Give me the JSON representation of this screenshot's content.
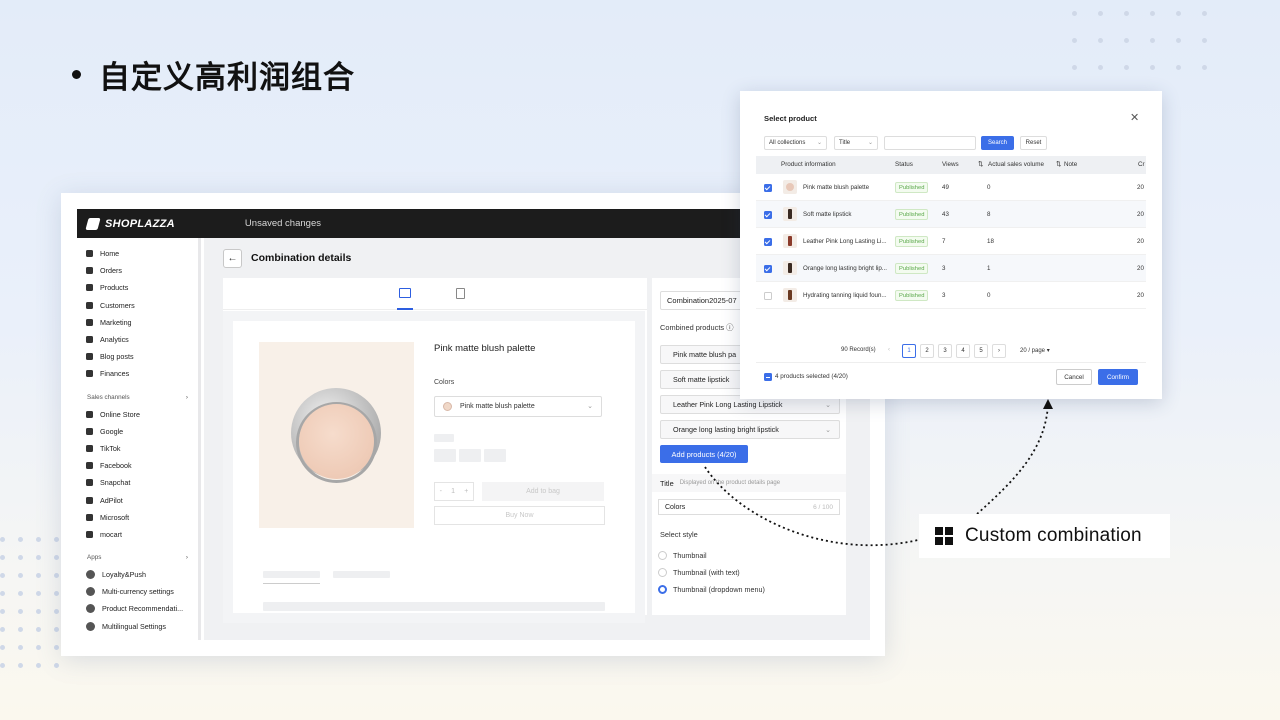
{
  "slide": {
    "title": "自定义高利润组合"
  },
  "topbar": {
    "logo": "SHOPLAZZA",
    "status": "Unsaved changes"
  },
  "sidebar": {
    "items": [
      {
        "label": "Home",
        "icon": "home-icon"
      },
      {
        "label": "Orders",
        "icon": "orders-icon"
      },
      {
        "label": "Products",
        "icon": "tag-icon"
      },
      {
        "label": "Customers",
        "icon": "user-icon"
      },
      {
        "label": "Marketing",
        "icon": "megaphone-icon"
      },
      {
        "label": "Analytics",
        "icon": "chart-icon"
      },
      {
        "label": "Blog posts",
        "icon": "blog-icon"
      },
      {
        "label": "Finances",
        "icon": "wallet-icon"
      }
    ],
    "sales_channels_label": "Sales channels",
    "channels": [
      {
        "label": "Online Store"
      },
      {
        "label": "Google"
      },
      {
        "label": "TikTok"
      },
      {
        "label": "Facebook"
      },
      {
        "label": "Snapchat"
      },
      {
        "label": "AdPilot"
      },
      {
        "label": "Microsoft"
      },
      {
        "label": "mocart"
      }
    ],
    "apps_label": "Apps",
    "apps": [
      {
        "label": "Loyalty&Push"
      },
      {
        "label": "Multi-currency settings"
      },
      {
        "label": "Product Recommendati..."
      },
      {
        "label": "Multilingual Settings"
      }
    ]
  },
  "main": {
    "page_title": "Combination details",
    "preview": {
      "product_name": "Pink matte blush palette",
      "colors_label": "Colors",
      "color_selected": "Pink matte blush palette",
      "qty_minus": "-",
      "qty_value": "1",
      "qty_plus": "+",
      "add_to_bag": "Add to bag",
      "buy_now": "Buy Now"
    },
    "settings": {
      "name_value": "Combination2025-07",
      "combined_products_label": "Combined products",
      "products": [
        "Pink matte blush pa",
        "Soft matte lipstick",
        "Leather Pink Long Lasting Lipstick",
        "Orange long lasting bright lipstick"
      ],
      "add_button": "Add products (4/20)",
      "title_label": "Title",
      "title_hint": "Displayed on the product details page",
      "title_value": "Colors",
      "title_counter": "6 / 100",
      "select_style_label": "Select style",
      "styles": [
        "Thumbnail",
        "Thumbnail (with text)",
        "Thumbnail (dropdown menu)"
      ],
      "selected_style": "Thumbnail (dropdown menu)"
    }
  },
  "modal": {
    "title": "Select product",
    "filter_collection": "All collections",
    "filter_field": "Title",
    "search_placeholder": "",
    "search_button": "Search",
    "reset_button": "Reset",
    "columns": [
      "Product information",
      "Status",
      "Views",
      "Actual sales volume",
      "Note",
      "Cr"
    ],
    "rows": [
      {
        "name": "Pink matte blush palette",
        "status": "Published",
        "views": "49",
        "sales": "0",
        "created": "20",
        "checked": true
      },
      {
        "name": "Soft matte lipstick",
        "status": "Published",
        "views": "43",
        "sales": "8",
        "created": "20",
        "checked": true
      },
      {
        "name": "Leather Pink Long Lasting Li...",
        "status": "Published",
        "views": "7",
        "sales": "18",
        "created": "20",
        "checked": true
      },
      {
        "name": "Orange long lasting bright lip...",
        "status": "Published",
        "views": "3",
        "sales": "1",
        "created": "20",
        "checked": true
      },
      {
        "name": "Hydrating tanning liquid foun...",
        "status": "Published",
        "views": "3",
        "sales": "0",
        "created": "20",
        "checked": false
      }
    ],
    "records": "90 Record(s)",
    "pages": [
      "1",
      "2",
      "3",
      "4",
      "5"
    ],
    "current_page": "1",
    "per_page": "20 / page",
    "selected_count": "4 products selected (4/20)",
    "cancel": "Cancel",
    "confirm": "Confirm"
  },
  "callout": {
    "label": "Custom combination"
  },
  "colors": {
    "accent": "#3b6ee8",
    "topbar": "#1c1c1c",
    "published": "#5aa84a"
  }
}
